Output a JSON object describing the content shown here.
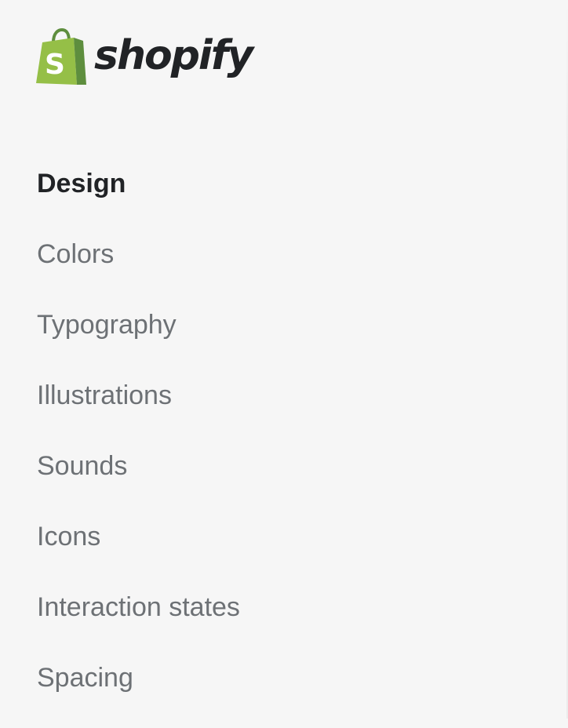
{
  "brand": {
    "name": "shopify",
    "logo_icon": "shopify-bag-icon",
    "logo_color": "#95bf47",
    "logo_dark_color": "#5e8e3e"
  },
  "sidebar": {
    "heading": "Design",
    "items": [
      {
        "label": "Colors"
      },
      {
        "label": "Typography"
      },
      {
        "label": "Illustrations"
      },
      {
        "label": "Sounds"
      },
      {
        "label": "Icons"
      },
      {
        "label": "Interaction states"
      },
      {
        "label": "Spacing"
      }
    ]
  },
  "colors": {
    "background": "#f6f6f6",
    "heading_text": "#212326",
    "item_text": "#6d7175"
  }
}
